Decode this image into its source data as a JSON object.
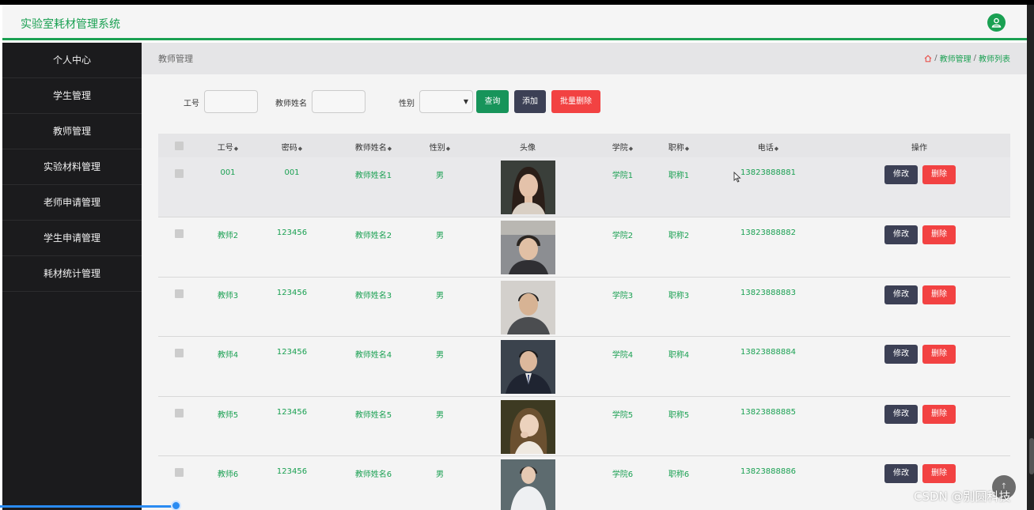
{
  "app": {
    "title": "实验室耗材管理系统"
  },
  "sidebar": {
    "items": [
      {
        "label": "个人中心"
      },
      {
        "label": "学生管理"
      },
      {
        "label": "教师管理"
      },
      {
        "label": "实验材料管理"
      },
      {
        "label": "老师申请管理"
      },
      {
        "label": "学生申请管理"
      },
      {
        "label": "耗材统计管理"
      }
    ]
  },
  "page": {
    "heading": "教师管理",
    "breadcrumb": [
      "教师管理",
      "教师列表"
    ]
  },
  "search": {
    "label_id": "工号",
    "value_id": "",
    "label_name": "教师姓名",
    "value_name": "",
    "label_gender": "性别",
    "value_gender": "",
    "query_label": "查询",
    "add_label": "添加",
    "batch_delete_label": "批量删除"
  },
  "table": {
    "headers": {
      "id": "工号",
      "password": "密码",
      "name": "教师姓名",
      "gender": "性别",
      "avatar": "头像",
      "college": "学院",
      "title": "职称",
      "phone": "电话",
      "ops": "操作"
    },
    "edit_label": "修改",
    "delete_label": "删除",
    "rows": [
      {
        "id": "001",
        "password": "001",
        "name": "教师姓名1",
        "gender": "男",
        "college": "学院1",
        "title": "职称1",
        "phone": "13823888881"
      },
      {
        "id": "教师2",
        "password": "123456",
        "name": "教师姓名2",
        "gender": "男",
        "college": "学院2",
        "title": "职称2",
        "phone": "13823888882"
      },
      {
        "id": "教师3",
        "password": "123456",
        "name": "教师姓名3",
        "gender": "男",
        "college": "学院3",
        "title": "职称3",
        "phone": "13823888883"
      },
      {
        "id": "教师4",
        "password": "123456",
        "name": "教师姓名4",
        "gender": "男",
        "college": "学院4",
        "title": "职称4",
        "phone": "13823888884"
      },
      {
        "id": "教师5",
        "password": "123456",
        "name": "教师姓名5",
        "gender": "男",
        "college": "学院5",
        "title": "职称5",
        "phone": "13823888885"
      },
      {
        "id": "教师6",
        "password": "123456",
        "name": "教师姓名6",
        "gender": "男",
        "college": "学院6",
        "title": "职称6",
        "phone": "13823888886"
      }
    ]
  },
  "watermark": "CSDN @别圆科技",
  "colors": {
    "brand": "#1aa052",
    "sidebar_bg": "#1b1b1d",
    "danger": "#f24242",
    "dark_button": "#3c4055"
  }
}
